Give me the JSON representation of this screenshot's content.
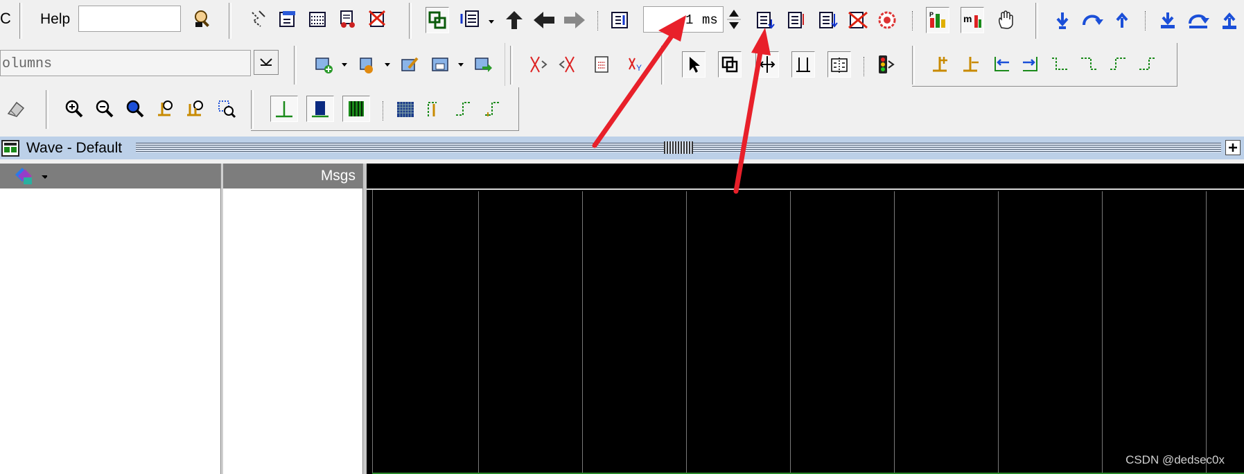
{
  "toolbar": {
    "help_label": "Help",
    "help_input_value": "",
    "run_length_value": "1",
    "run_length_unit": "ms",
    "columns_combo_value": "olumns"
  },
  "icons": {
    "row1": [
      "search-help-icon",
      "step-icon",
      "edit-list-icon",
      "wave-calendar-icon",
      "script-icon",
      "delete-list-icon",
      "link-icon",
      "insert-list-icon",
      "up-arrow-icon",
      "left-arrow-icon",
      "right-arrow-icon",
      "restart-icon",
      "run-icon",
      "continue-icon",
      "run-all-icon",
      "break-icon",
      "stop-icon",
      "profile-icon",
      "memory-icon",
      "hand-icon",
      "step-into-icon",
      "step-over-icon",
      "step-out-icon",
      "step-into-2-icon",
      "step-over-2-icon",
      "step-out-2-icon"
    ],
    "row2": [
      "add-wave-icon",
      "add-wave-2-icon",
      "edit-wave-icon",
      "save-wave-icon",
      "export-wave-icon",
      "cut-icon",
      "cut-2-icon",
      "copy-icon",
      "paste-icon",
      "select-pointer-icon",
      "zoom-box-icon",
      "cursor-icon",
      "cursor-link-icon",
      "dataflow-icon",
      "traffic-light-icon",
      "cursor-add-icon",
      "cursor-delete-icon",
      "edge-left-icon",
      "edge-right-icon",
      "edge-prev-icon",
      "edge-next-icon",
      "edge-prev-2-icon",
      "edge-next-2-icon"
    ],
    "row3": [
      "eraser-icon",
      "zoom-in-icon",
      "zoom-out-icon",
      "zoom-full-icon",
      "zoom-cursor-icon",
      "zoom-cursors-icon",
      "zoom-region-icon",
      "wave-literal-icon",
      "wave-logic-icon",
      "wave-analog-icon",
      "wave-hatch-icon",
      "wave-step-icon",
      "wave-step-2-icon",
      "wave-step-3-icon"
    ]
  },
  "wave": {
    "title": "Wave - Default",
    "msgs_header": "Msgs"
  },
  "watermark": "CSDN @dedsec0x",
  "colors": {
    "annotation_arrow": "#e8202a",
    "title_bar": "#bcd0e8",
    "header": "#7d7d7d",
    "wave_bg": "#000000"
  }
}
